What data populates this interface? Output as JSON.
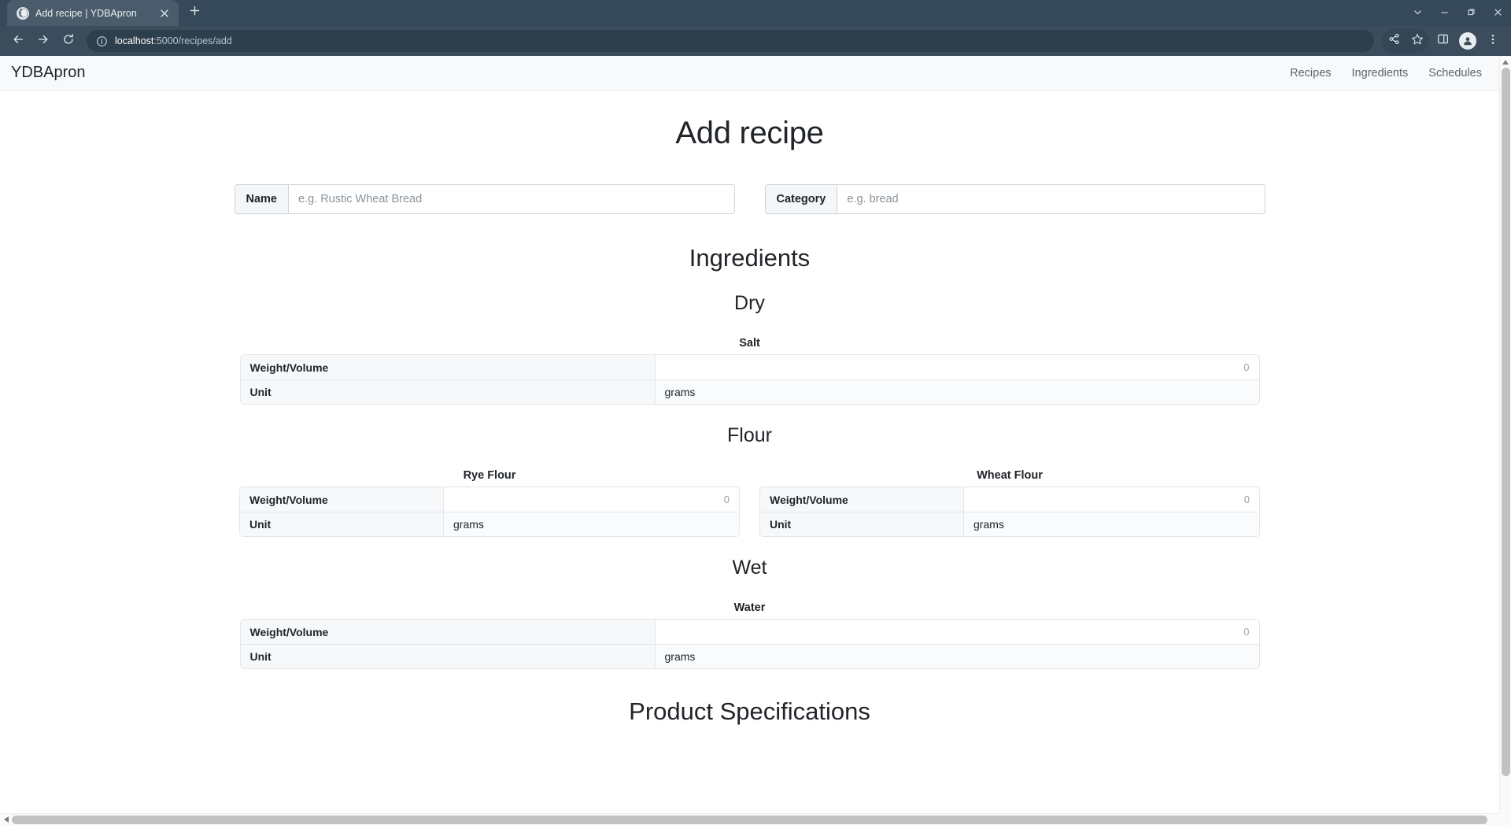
{
  "browser": {
    "tab": {
      "title": "Add recipe | YDBApron",
      "favicon_icon": "globe-icon",
      "close_icon": "close-icon"
    },
    "new_tab_icon": "plus-icon",
    "window_controls": [
      {
        "name": "tab-search-button",
        "icon": "chevron-down-icon"
      },
      {
        "name": "minimize-button",
        "icon": "minimize-icon"
      },
      {
        "name": "maximize-button",
        "icon": "maximize-icon"
      },
      {
        "name": "close-window-button",
        "icon": "close-icon"
      }
    ],
    "toolbar": {
      "back_icon": "back-arrow-icon",
      "forward_icon": "forward-arrow-icon",
      "reload_icon": "reload-icon",
      "site_info_icon": "info-circle-icon",
      "url_host": "localhost",
      "url_path": ":5000/recipes/add",
      "url_full": "localhost:5000/recipes/add",
      "share_icon": "share-icon",
      "bookmark_icon": "star-icon",
      "side_panel_icon": "side-panel-icon",
      "profile_icon": "profile-avatar-icon",
      "menu_icon": "three-dot-menu-icon"
    }
  },
  "navbar": {
    "brand": "YDBApron",
    "links": [
      {
        "label": "Recipes"
      },
      {
        "label": "Ingredients"
      },
      {
        "label": "Schedules"
      }
    ]
  },
  "page": {
    "title": "Add recipe",
    "fields": [
      {
        "label": "Name",
        "value": "",
        "placeholder": "e.g. Rustic Wheat Bread"
      },
      {
        "label": "Category",
        "value": "",
        "placeholder": "e.g. bread"
      }
    ],
    "ingredients_heading": "Ingredients",
    "row_labels": {
      "weight_volume": "Weight/Volume",
      "unit": "Unit"
    },
    "amount_placeholder": "0",
    "sections": [
      {
        "heading": "Dry",
        "groups": [
          {
            "heading": null,
            "items": [
              {
                "name": "Salt",
                "amount": "",
                "unit": "grams"
              }
            ]
          },
          {
            "heading": "Flour",
            "items": [
              {
                "name": "Rye Flour",
                "amount": "",
                "unit": "grams"
              },
              {
                "name": "Wheat Flour",
                "amount": "",
                "unit": "grams"
              }
            ]
          }
        ]
      },
      {
        "heading": "Wet",
        "groups": [
          {
            "heading": null,
            "items": [
              {
                "name": "Water",
                "amount": "",
                "unit": "grams"
              }
            ]
          }
        ]
      }
    ],
    "product_specifications_heading": "Product Specifications"
  }
}
